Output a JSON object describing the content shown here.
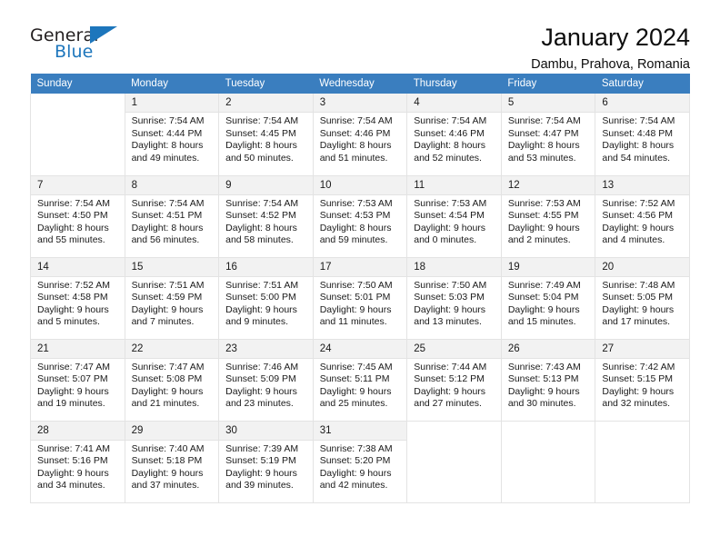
{
  "brand": {
    "word_one": "General",
    "word_two": "Blue",
    "color_dark": "#231f20",
    "color_blue": "#1d76bc"
  },
  "header": {
    "title": "January 2024",
    "subtitle": "Dambu, Prahova, Romania"
  },
  "calendar": {
    "header_bg": "#3a7ebf",
    "daynum_bg": "#f2f2f2",
    "weekdays": [
      "Sunday",
      "Monday",
      "Tuesday",
      "Wednesday",
      "Thursday",
      "Friday",
      "Saturday"
    ],
    "weeks": [
      [
        {
          "day": "",
          "sunrise": "",
          "sunset": "",
          "daylight_line1": "",
          "daylight_line2": ""
        },
        {
          "day": "1",
          "sunrise": "Sunrise: 7:54 AM",
          "sunset": "Sunset: 4:44 PM",
          "daylight_line1": "Daylight: 8 hours",
          "daylight_line2": "and 49 minutes."
        },
        {
          "day": "2",
          "sunrise": "Sunrise: 7:54 AM",
          "sunset": "Sunset: 4:45 PM",
          "daylight_line1": "Daylight: 8 hours",
          "daylight_line2": "and 50 minutes."
        },
        {
          "day": "3",
          "sunrise": "Sunrise: 7:54 AM",
          "sunset": "Sunset: 4:46 PM",
          "daylight_line1": "Daylight: 8 hours",
          "daylight_line2": "and 51 minutes."
        },
        {
          "day": "4",
          "sunrise": "Sunrise: 7:54 AM",
          "sunset": "Sunset: 4:46 PM",
          "daylight_line1": "Daylight: 8 hours",
          "daylight_line2": "and 52 minutes."
        },
        {
          "day": "5",
          "sunrise": "Sunrise: 7:54 AM",
          "sunset": "Sunset: 4:47 PM",
          "daylight_line1": "Daylight: 8 hours",
          "daylight_line2": "and 53 minutes."
        },
        {
          "day": "6",
          "sunrise": "Sunrise: 7:54 AM",
          "sunset": "Sunset: 4:48 PM",
          "daylight_line1": "Daylight: 8 hours",
          "daylight_line2": "and 54 minutes."
        }
      ],
      [
        {
          "day": "7",
          "sunrise": "Sunrise: 7:54 AM",
          "sunset": "Sunset: 4:50 PM",
          "daylight_line1": "Daylight: 8 hours",
          "daylight_line2": "and 55 minutes."
        },
        {
          "day": "8",
          "sunrise": "Sunrise: 7:54 AM",
          "sunset": "Sunset: 4:51 PM",
          "daylight_line1": "Daylight: 8 hours",
          "daylight_line2": "and 56 minutes."
        },
        {
          "day": "9",
          "sunrise": "Sunrise: 7:54 AM",
          "sunset": "Sunset: 4:52 PM",
          "daylight_line1": "Daylight: 8 hours",
          "daylight_line2": "and 58 minutes."
        },
        {
          "day": "10",
          "sunrise": "Sunrise: 7:53 AM",
          "sunset": "Sunset: 4:53 PM",
          "daylight_line1": "Daylight: 8 hours",
          "daylight_line2": "and 59 minutes."
        },
        {
          "day": "11",
          "sunrise": "Sunrise: 7:53 AM",
          "sunset": "Sunset: 4:54 PM",
          "daylight_line1": "Daylight: 9 hours",
          "daylight_line2": "and 0 minutes."
        },
        {
          "day": "12",
          "sunrise": "Sunrise: 7:53 AM",
          "sunset": "Sunset: 4:55 PM",
          "daylight_line1": "Daylight: 9 hours",
          "daylight_line2": "and 2 minutes."
        },
        {
          "day": "13",
          "sunrise": "Sunrise: 7:52 AM",
          "sunset": "Sunset: 4:56 PM",
          "daylight_line1": "Daylight: 9 hours",
          "daylight_line2": "and 4 minutes."
        }
      ],
      [
        {
          "day": "14",
          "sunrise": "Sunrise: 7:52 AM",
          "sunset": "Sunset: 4:58 PM",
          "daylight_line1": "Daylight: 9 hours",
          "daylight_line2": "and 5 minutes."
        },
        {
          "day": "15",
          "sunrise": "Sunrise: 7:51 AM",
          "sunset": "Sunset: 4:59 PM",
          "daylight_line1": "Daylight: 9 hours",
          "daylight_line2": "and 7 minutes."
        },
        {
          "day": "16",
          "sunrise": "Sunrise: 7:51 AM",
          "sunset": "Sunset: 5:00 PM",
          "daylight_line1": "Daylight: 9 hours",
          "daylight_line2": "and 9 minutes."
        },
        {
          "day": "17",
          "sunrise": "Sunrise: 7:50 AM",
          "sunset": "Sunset: 5:01 PM",
          "daylight_line1": "Daylight: 9 hours",
          "daylight_line2": "and 11 minutes."
        },
        {
          "day": "18",
          "sunrise": "Sunrise: 7:50 AM",
          "sunset": "Sunset: 5:03 PM",
          "daylight_line1": "Daylight: 9 hours",
          "daylight_line2": "and 13 minutes."
        },
        {
          "day": "19",
          "sunrise": "Sunrise: 7:49 AM",
          "sunset": "Sunset: 5:04 PM",
          "daylight_line1": "Daylight: 9 hours",
          "daylight_line2": "and 15 minutes."
        },
        {
          "day": "20",
          "sunrise": "Sunrise: 7:48 AM",
          "sunset": "Sunset: 5:05 PM",
          "daylight_line1": "Daylight: 9 hours",
          "daylight_line2": "and 17 minutes."
        }
      ],
      [
        {
          "day": "21",
          "sunrise": "Sunrise: 7:47 AM",
          "sunset": "Sunset: 5:07 PM",
          "daylight_line1": "Daylight: 9 hours",
          "daylight_line2": "and 19 minutes."
        },
        {
          "day": "22",
          "sunrise": "Sunrise: 7:47 AM",
          "sunset": "Sunset: 5:08 PM",
          "daylight_line1": "Daylight: 9 hours",
          "daylight_line2": "and 21 minutes."
        },
        {
          "day": "23",
          "sunrise": "Sunrise: 7:46 AM",
          "sunset": "Sunset: 5:09 PM",
          "daylight_line1": "Daylight: 9 hours",
          "daylight_line2": "and 23 minutes."
        },
        {
          "day": "24",
          "sunrise": "Sunrise: 7:45 AM",
          "sunset": "Sunset: 5:11 PM",
          "daylight_line1": "Daylight: 9 hours",
          "daylight_line2": "and 25 minutes."
        },
        {
          "day": "25",
          "sunrise": "Sunrise: 7:44 AM",
          "sunset": "Sunset: 5:12 PM",
          "daylight_line1": "Daylight: 9 hours",
          "daylight_line2": "and 27 minutes."
        },
        {
          "day": "26",
          "sunrise": "Sunrise: 7:43 AM",
          "sunset": "Sunset: 5:13 PM",
          "daylight_line1": "Daylight: 9 hours",
          "daylight_line2": "and 30 minutes."
        },
        {
          "day": "27",
          "sunrise": "Sunrise: 7:42 AM",
          "sunset": "Sunset: 5:15 PM",
          "daylight_line1": "Daylight: 9 hours",
          "daylight_line2": "and 32 minutes."
        }
      ],
      [
        {
          "day": "28",
          "sunrise": "Sunrise: 7:41 AM",
          "sunset": "Sunset: 5:16 PM",
          "daylight_line1": "Daylight: 9 hours",
          "daylight_line2": "and 34 minutes."
        },
        {
          "day": "29",
          "sunrise": "Sunrise: 7:40 AM",
          "sunset": "Sunset: 5:18 PM",
          "daylight_line1": "Daylight: 9 hours",
          "daylight_line2": "and 37 minutes."
        },
        {
          "day": "30",
          "sunrise": "Sunrise: 7:39 AM",
          "sunset": "Sunset: 5:19 PM",
          "daylight_line1": "Daylight: 9 hours",
          "daylight_line2": "and 39 minutes."
        },
        {
          "day": "31",
          "sunrise": "Sunrise: 7:38 AM",
          "sunset": "Sunset: 5:20 PM",
          "daylight_line1": "Daylight: 9 hours",
          "daylight_line2": "and 42 minutes."
        },
        {
          "day": "",
          "sunrise": "",
          "sunset": "",
          "daylight_line1": "",
          "daylight_line2": ""
        },
        {
          "day": "",
          "sunrise": "",
          "sunset": "",
          "daylight_line1": "",
          "daylight_line2": ""
        },
        {
          "day": "",
          "sunrise": "",
          "sunset": "",
          "daylight_line1": "",
          "daylight_line2": ""
        }
      ]
    ]
  }
}
